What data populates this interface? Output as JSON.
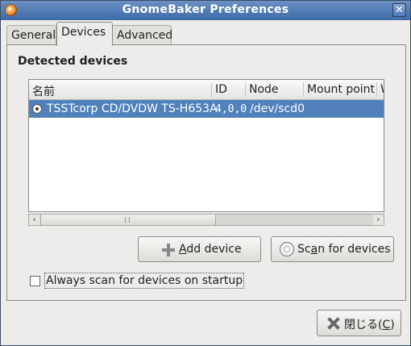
{
  "window": {
    "title": "GnomeBaker Preferences",
    "close_glyph": "✕"
  },
  "tabs": [
    {
      "label": "General"
    },
    {
      "label": "Devices"
    },
    {
      "label": "Advanced"
    }
  ],
  "devices_tab": {
    "section_title": "Detected devices",
    "columns": [
      "名前",
      "ID",
      "Node",
      "Mount point",
      "W"
    ],
    "rows": [
      {
        "name": "TSSTcorp CD/DVDW TS-H653A",
        "id": "4,0,0",
        "node": "/dev/scd0",
        "selected": true
      }
    ],
    "scrollbar": {
      "left_arrow": "‹",
      "right_arrow": "›"
    },
    "add_device": {
      "prefix": "",
      "mnemonic": "A",
      "rest": "dd device",
      "icon": "add-icon"
    },
    "scan_devices": {
      "prefix": "Sc",
      "mnemonic": "a",
      "rest": "n for devices",
      "icon": "disc-icon"
    },
    "always_scan": {
      "label": "Always scan for devices on startup",
      "checked": false
    }
  },
  "footer": {
    "close_button": {
      "prefix": "閉じる(",
      "mnemonic": "C",
      "suffix": ")",
      "icon": "close-icon"
    }
  },
  "colors": {
    "selection": "#5081bd",
    "titlebar": "#4f79b3"
  }
}
